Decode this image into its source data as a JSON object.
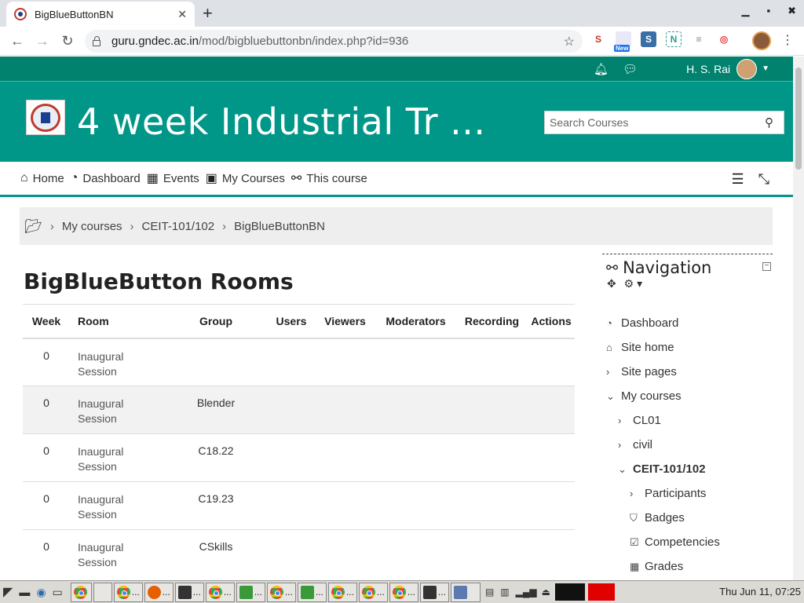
{
  "browser": {
    "tab_title": "BigBlueButtonBN",
    "url_host": "guru.gndec.ac.in",
    "url_path": "/mod/bigbluebuttonbn/index.php?id=936",
    "new_badge": "New"
  },
  "topbar": {
    "user_name": "H. S. Rai"
  },
  "header": {
    "site_title": "4 week Industrial Tr ...",
    "search_placeholder": "Search Courses"
  },
  "nav": {
    "home": "Home",
    "dashboard": "Dashboard",
    "events": "Events",
    "my_courses": "My Courses",
    "this_course": "This course"
  },
  "breadcrumb": {
    "items": [
      "My courses",
      "CEIT-101/102",
      "BigBlueButtonBN"
    ]
  },
  "main": {
    "title": "BigBlueButton Rooms",
    "columns": [
      "Week",
      "Room",
      "Group",
      "Users",
      "Viewers",
      "Moderators",
      "Recording",
      "Actions"
    ],
    "rows": [
      {
        "week": "0",
        "room": "Inaugural Session",
        "group": ""
      },
      {
        "week": "0",
        "room": "Inaugural Session",
        "group": "Blender"
      },
      {
        "week": "0",
        "room": "Inaugural Session",
        "group": "C18.22"
      },
      {
        "week": "0",
        "room": "Inaugural Session",
        "group": "C19.23"
      },
      {
        "week": "0",
        "room": "Inaugural Session",
        "group": "CSkills"
      }
    ]
  },
  "navigation": {
    "title": "Navigation",
    "items": {
      "dashboard": "Dashboard",
      "site_home": "Site home",
      "site_pages": "Site pages",
      "my_courses": "My courses",
      "cl01": "CL01",
      "civil": "civil",
      "ceit": "CEIT-101/102",
      "participants": "Participants",
      "badges": "Badges",
      "competencies": "Competencies",
      "grades": "Grades"
    }
  },
  "taskbar": {
    "clock": "Thu Jun 11, 07:25",
    "item_label": "..."
  },
  "colors": {
    "brand": "#009688",
    "brand_dark": "#00826f"
  }
}
